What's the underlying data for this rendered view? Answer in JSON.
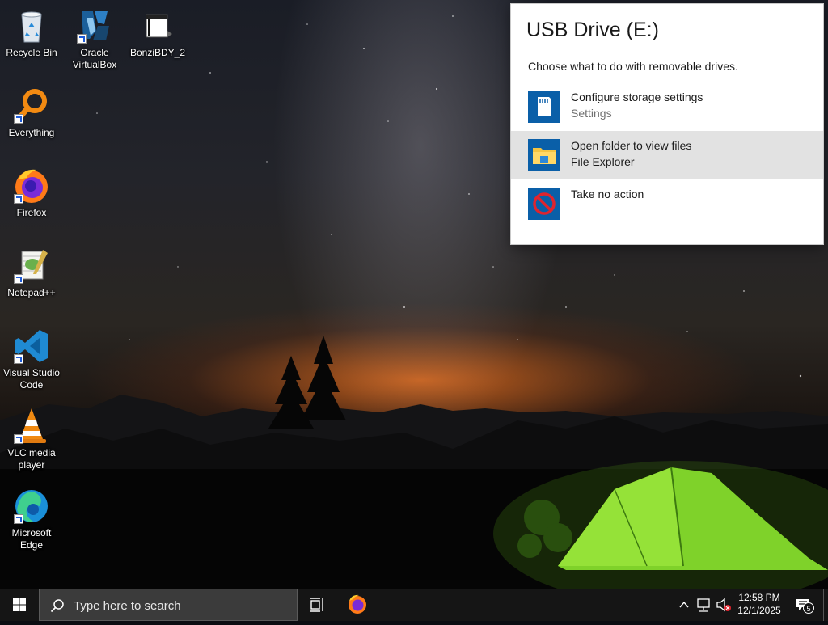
{
  "desktop": {
    "icons": [
      {
        "label": "Recycle Bin",
        "icon": "recycle-bin-icon"
      },
      {
        "label": "Oracle VirtualBox",
        "icon": "virtualbox-icon"
      },
      {
        "label": "BonziBDY_2",
        "icon": "bonzi-file-icon"
      },
      {
        "label": "Everything",
        "icon": "everything-search-icon"
      },
      {
        "label": "Firefox",
        "icon": "firefox-icon"
      },
      {
        "label": "Notepad++",
        "icon": "notepadpp-icon"
      },
      {
        "label": "Visual Studio Code",
        "icon": "vscode-icon"
      },
      {
        "label": "VLC media player",
        "icon": "vlc-icon"
      },
      {
        "label": "Microsoft Edge",
        "icon": "edge-icon"
      }
    ]
  },
  "autoplay": {
    "title": "USB Drive (E:)",
    "subtitle": "Choose what to do with removable drives.",
    "options": [
      {
        "label": "Configure storage settings",
        "sub": "Settings",
        "icon": "sd-card-icon"
      },
      {
        "label": "Open folder to view files",
        "sub": "File Explorer",
        "icon": "folder-icon"
      },
      {
        "label": "Take no action",
        "sub": "",
        "icon": "no-action-icon"
      }
    ],
    "accent": "#0a5fa8"
  },
  "taskbar": {
    "search_placeholder": "Type here to search",
    "time": "12:58 PM",
    "date": "12/1/2025",
    "notification_count": "5",
    "background": "#151515"
  }
}
